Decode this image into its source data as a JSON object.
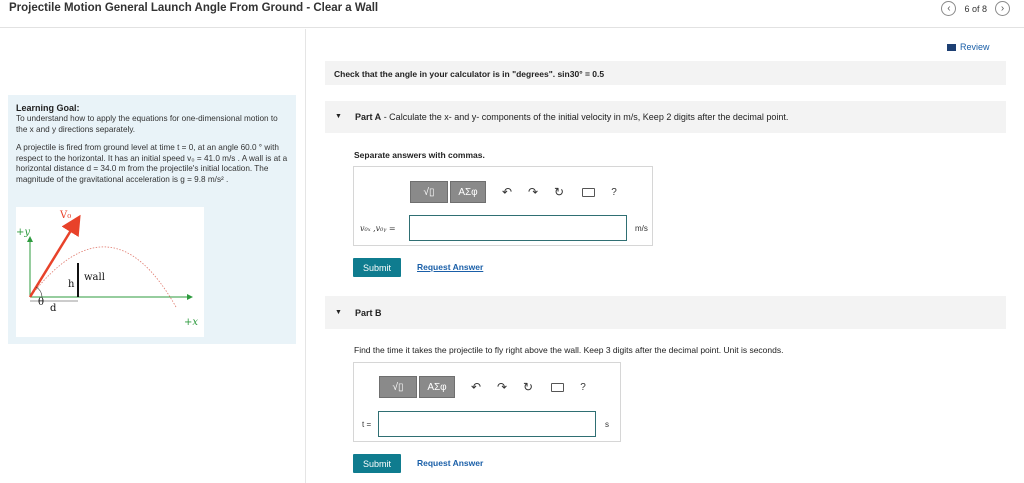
{
  "header": {
    "title": "Projectile Motion General Launch Angle From Ground - Clear a Wall",
    "prev_icon": "chevron-left-icon",
    "next_icon": "chevron-right-icon",
    "pager": "6 of 8"
  },
  "review": {
    "label": "Review",
    "icon": "review-bars-icon"
  },
  "goal": {
    "title": "Learning Goal:",
    "body": "To understand how to apply the equations for one-dimensional motion to the x and y directions separately.",
    "problem": "A projectile is fired from ground level at time t = 0, at an angle 60.0 ° with respect to the horizontal. It has an initial speed v₀ = 41.0 m/s . A wall is at a horizontal distance d = 34.0 m from the projectile's initial location. The magnitude of the gravitational acceleration is g = 9.8 m/s² .",
    "figure": {
      "v0": "V₀",
      "y_axis": "+y",
      "x_axis": "+x",
      "theta": "θ",
      "d": "d",
      "h": "h",
      "wall": "wall"
    }
  },
  "check_text": "Check that the angle in your calculator is in \"degrees\". sin30° = 0.5",
  "part_a": {
    "label_bold": "Part A",
    "label_rest": " - Calculate the x- and y- components of the initial velocity in m/s, Keep 2 digits after the decimal point.",
    "separate": "Separate answers with commas.",
    "eq_label": "v₀ₓ ,v₀ᵧ =",
    "unit": "m/s",
    "input_value": "",
    "submit": "Submit",
    "request": "Request Answer"
  },
  "part_b": {
    "label": "Part B",
    "find": "Find the time  it takes the projectile to fly right above the wall. Keep 3 digits after the decimal point. Unit is seconds.",
    "eq_label": "t =",
    "unit": "s",
    "input_value": "",
    "submit": "Submit",
    "request": "Request Answer"
  },
  "toolbar": {
    "templates": "√▯",
    "symbols": "ΑΣφ",
    "undo": "↶",
    "redo": "↷",
    "reset": "↻",
    "help": "?"
  },
  "colors": {
    "accent": "#0f7c8f",
    "link": "#1a5fa8",
    "goal_bg": "#e9f3f8",
    "trajectory": "#e07a6e",
    "arrow": "#e8422a",
    "axis": "#2e9b3e"
  }
}
